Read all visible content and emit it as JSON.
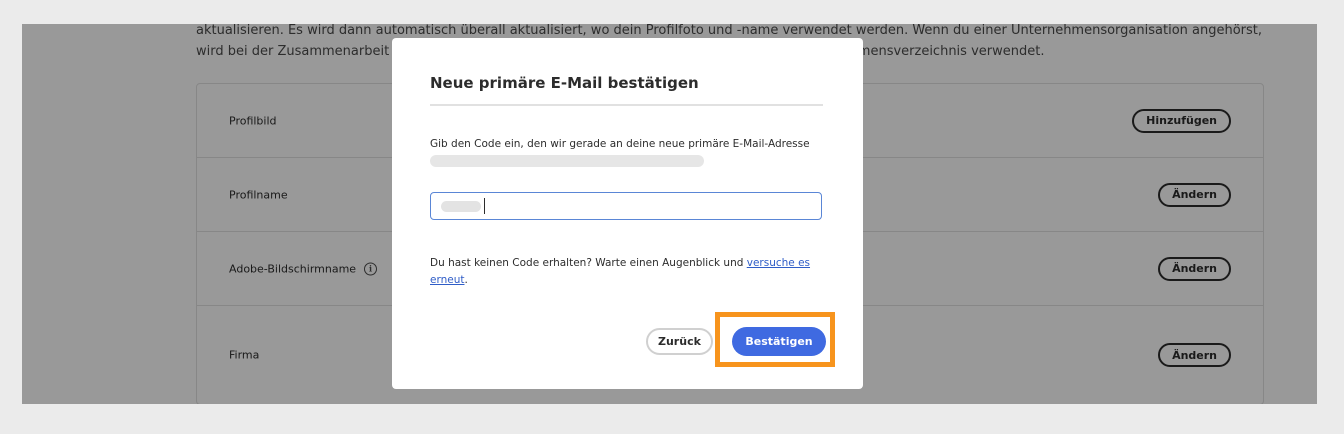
{
  "intro": {
    "line1": "aktualisieren. Es wird dann automatisch überall aktualisiert, wo dein Profilfoto und -name verwendet werden. Wenn du einer Unternehmensorganisation angehörst,",
    "line2": "wird bei der Zusammenarbeit mit Kolleginnen und Kollegen dein Profilname zuerst aus dem Unternehmensverzeichnis verwendet."
  },
  "profile_rows": [
    {
      "label": "Profilbild",
      "button": "Hinzufügen"
    },
    {
      "label": "Profilname",
      "button": "Ändern"
    },
    {
      "label": "Adobe-Bildschirmname",
      "button": "Ändern"
    },
    {
      "label": "Firma",
      "button": "Ändern"
    }
  ],
  "modal": {
    "title": "Neue primäre E-Mail bestätigen",
    "description": "Gib den Code ein, den wir gerade an deine neue primäre E-Mail-Adresse",
    "resend_text": "Du hast keinen Code erhalten? Warte einen Augenblick und ",
    "resend_link": "versuche es erneut",
    "resend_end": ".",
    "back_label": "Zurück",
    "confirm_label": "Bestätigen"
  },
  "colors": {
    "accent": "#3f6ae1",
    "highlight": "#f7941d",
    "link": "#2f5dc7"
  }
}
